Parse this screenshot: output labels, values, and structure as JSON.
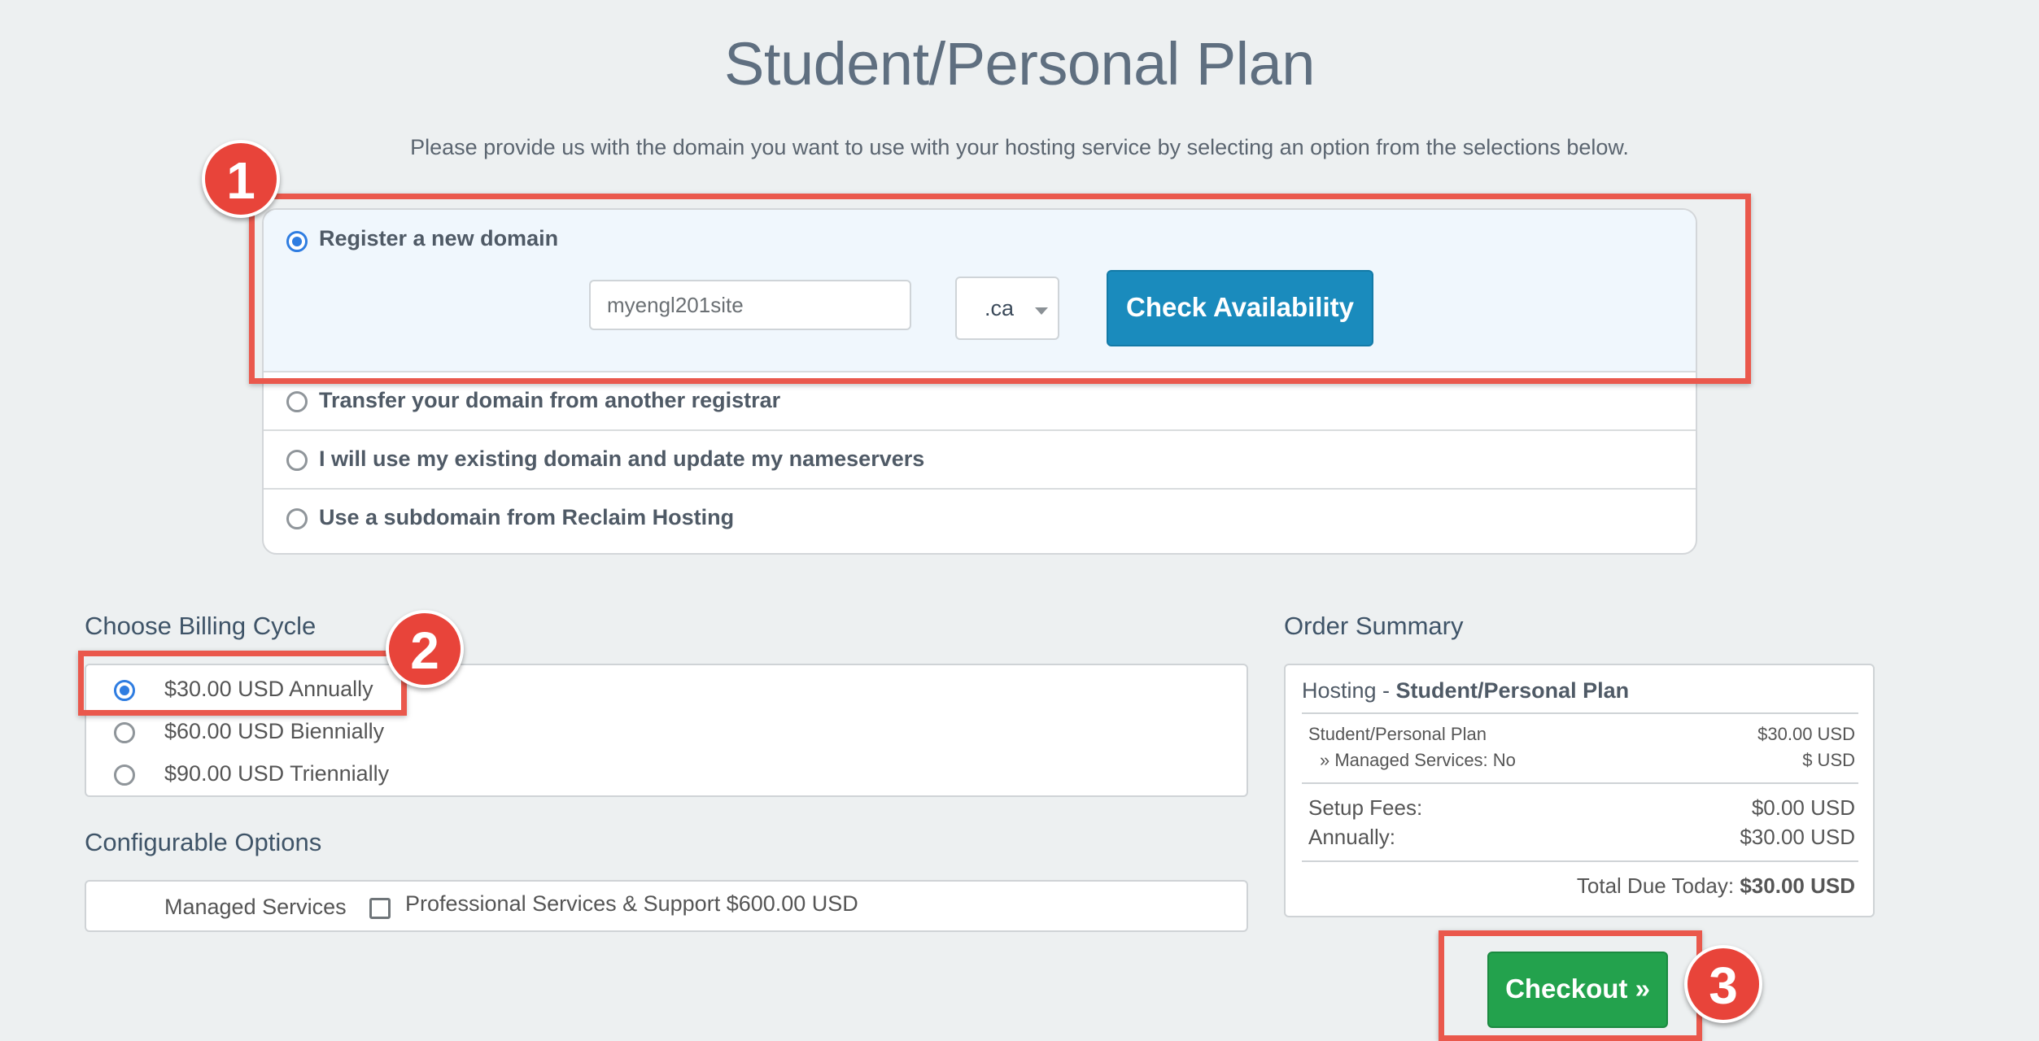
{
  "page": {
    "title": "Student/Personal Plan",
    "subtitle": "Please provide us with the domain you want to use with your hosting service by selecting an option from the selections below."
  },
  "domain": {
    "options": [
      {
        "label": "Register a new domain",
        "selected": true
      },
      {
        "label": "Transfer your domain from another registrar",
        "selected": false
      },
      {
        "label": "I will use my existing domain and update my nameservers",
        "selected": false
      },
      {
        "label": "Use a subdomain from Reclaim Hosting",
        "selected": false
      }
    ],
    "input_value": "myengl201site",
    "tld": ".ca",
    "check_label": "Check Availability"
  },
  "billing": {
    "heading": "Choose Billing Cycle",
    "options": [
      {
        "label": "$30.00 USD Annually",
        "selected": true
      },
      {
        "label": "$60.00 USD Biennially",
        "selected": false
      },
      {
        "label": "$90.00 USD Triennially",
        "selected": false
      }
    ]
  },
  "config": {
    "heading": "Configurable Options",
    "label": "Managed Services",
    "checkbox_label": "Professional Services & Support $600.00 USD"
  },
  "summary": {
    "heading": "Order Summary",
    "product_prefix": "Hosting - ",
    "product_name": "Student/Personal Plan",
    "lines": [
      {
        "label": "Student/Personal Plan",
        "value": "$30.00 USD"
      },
      {
        "label": "» Managed Services: No",
        "value": "$ USD"
      }
    ],
    "fees": [
      {
        "label": "Setup Fees:",
        "value": "$0.00 USD"
      },
      {
        "label": "Annually:",
        "value": "$30.00 USD"
      }
    ],
    "total_label": "Total Due Today:",
    "total_value": "$30.00 USD"
  },
  "checkout_label": "Checkout »",
  "annotations": {
    "badge_1": "1",
    "badge_2": "2",
    "badge_3": "3",
    "highlight_color": "#ea584c"
  }
}
